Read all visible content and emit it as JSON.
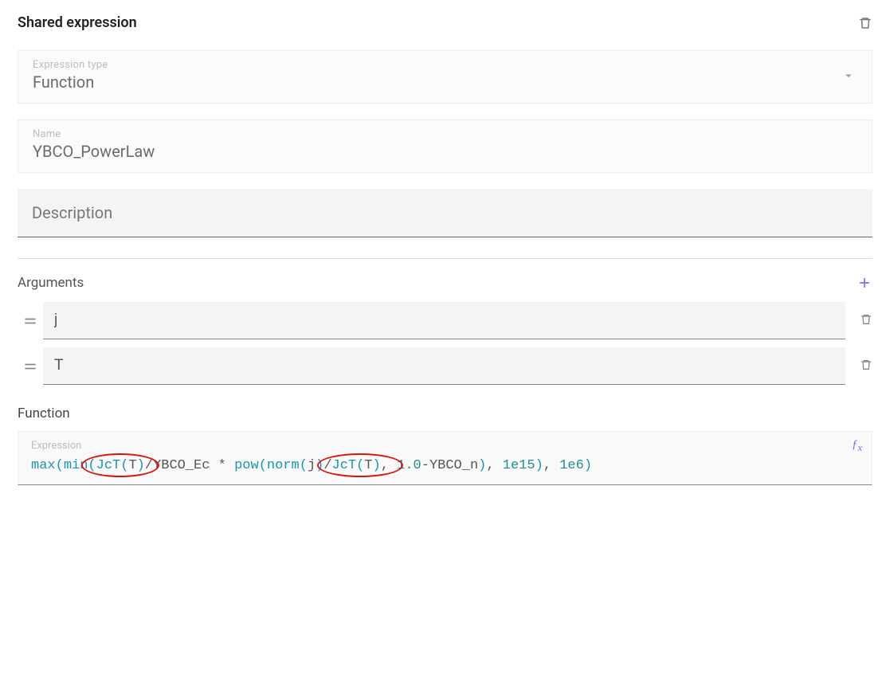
{
  "header": {
    "title": "Shared expression"
  },
  "expression_type": {
    "label": "Expression type",
    "value": "Function"
  },
  "name_field": {
    "label": "Name",
    "value": "YBCO_PowerLaw"
  },
  "description": {
    "placeholder": "Description",
    "value": ""
  },
  "arguments": {
    "label": "Arguments",
    "items": [
      {
        "value": "j"
      },
      {
        "value": "T"
      }
    ]
  },
  "function_section": {
    "label": "Function",
    "expression_label": "Expression",
    "tokens": [
      {
        "t": "func",
        "v": "max"
      },
      {
        "t": "paren",
        "v": "("
      },
      {
        "t": "func",
        "v": "min"
      },
      {
        "t": "paren",
        "v": "("
      },
      {
        "t": "func",
        "v": "JcT"
      },
      {
        "t": "paren",
        "v": "("
      },
      {
        "t": "id",
        "v": "T"
      },
      {
        "t": "paren",
        "v": ")"
      },
      {
        "t": "op",
        "v": "/"
      },
      {
        "t": "id",
        "v": "YBCO_Ec"
      },
      {
        "t": "op",
        "v": " * "
      },
      {
        "t": "func",
        "v": "pow"
      },
      {
        "t": "paren",
        "v": "("
      },
      {
        "t": "func",
        "v": "norm"
      },
      {
        "t": "paren",
        "v": "("
      },
      {
        "t": "id",
        "v": "j"
      },
      {
        "t": "paren",
        "v": ")"
      },
      {
        "t": "op",
        "v": "/"
      },
      {
        "t": "func",
        "v": "JcT"
      },
      {
        "t": "paren",
        "v": "("
      },
      {
        "t": "id",
        "v": "T"
      },
      {
        "t": "paren",
        "v": ")"
      },
      {
        "t": "op",
        "v": ", "
      },
      {
        "t": "num",
        "v": "1.0"
      },
      {
        "t": "op",
        "v": "-"
      },
      {
        "t": "id",
        "v": "YBCO_n"
      },
      {
        "t": "paren",
        "v": ")"
      },
      {
        "t": "op",
        "v": ", "
      },
      {
        "t": "num",
        "v": "1e15"
      },
      {
        "t": "paren",
        "v": ")"
      },
      {
        "t": "op",
        "v": ", "
      },
      {
        "t": "num",
        "v": "1e6"
      },
      {
        "t": "paren",
        "v": ")"
      }
    ]
  },
  "icons": {
    "trash": "trash-icon",
    "chevron": "chevron-down-icon",
    "plus": "plus-icon",
    "drag": "drag-handle-icon",
    "fx": "fx-icon"
  },
  "annotations": {
    "ellipses": [
      {
        "target_token_index_start": 3,
        "note": "JcT(T) first occurrence"
      },
      {
        "target_token_index_start": 17,
        "note": "JcT(T) second occurrence"
      }
    ]
  }
}
